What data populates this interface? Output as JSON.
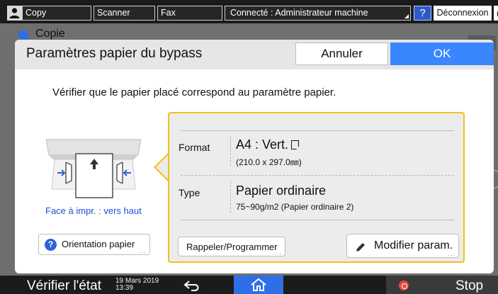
{
  "topbar": {
    "tabs": [
      {
        "label": "Copy"
      },
      {
        "label": "Scanner"
      },
      {
        "label": "Fax"
      }
    ],
    "admin_label": "Connecté : Administrateur machine",
    "help_label": "?",
    "logout_label": "Déconnexion",
    "moon_label": "("
  },
  "background": {
    "app_title": "Copie"
  },
  "dialog": {
    "title": "Paramètres papier du bypass",
    "cancel_label": "Annuler",
    "ok_label": "OK",
    "message": "Vérifier que le papier placé correspond au paramètre papier.",
    "face_label": "Face à impr. : vers haut",
    "orientation_label": "Orientation papier",
    "format": {
      "label": "Format",
      "value": "A4 : Vert.",
      "dimensions": "(210.0 x 297.0㎜)"
    },
    "type": {
      "label": "Type",
      "value": "Papier ordinaire",
      "detail": "75~90g/m2 (Papier ordinaire 2)"
    },
    "recall_label": "Rappeler/Programmer",
    "modify_label": "Modifier param."
  },
  "bottombar": {
    "status_label": "Vérifier l'état",
    "date": "19 Mars 2019",
    "time": "13:39",
    "stop_label": "Stop"
  },
  "colors": {
    "accent_blue": "#3a86ff",
    "panel_border": "#f2c21b",
    "home_blue": "#2f6fe6",
    "stop_red": "#e24b3b"
  }
}
